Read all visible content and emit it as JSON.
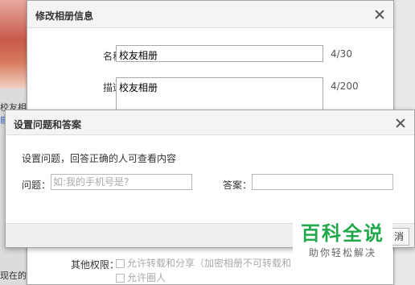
{
  "background": {
    "snippets": [
      "校友相",
      "现在的"
    ]
  },
  "album_dialog": {
    "title": "修改相册信息",
    "name_label": "名称：",
    "name_value": "校友相册",
    "name_counter": "4/30",
    "desc_label": "描述：",
    "desc_value": "校友相册",
    "desc_counter": "4/200",
    "other_perm_label": "其他权限：",
    "perms": [
      {
        "label": "允许转载和分享（加密相册不可转载和",
        "checked": false,
        "disabled": true
      },
      {
        "label": "允许圈人",
        "checked": false,
        "disabled": true
      }
    ]
  },
  "question_dialog": {
    "title": "设置问题和答案",
    "description": "设置问题，回答正确的人可查看内容",
    "question_label": "问题：",
    "question_placeholder": "如:我的手机号是?",
    "answer_label": "答案：",
    "answer_value": "",
    "cancel_label": "消"
  },
  "watermark": {
    "title": "百科全说",
    "subtitle": "助你轻松解决",
    "color": "#22a74a"
  }
}
